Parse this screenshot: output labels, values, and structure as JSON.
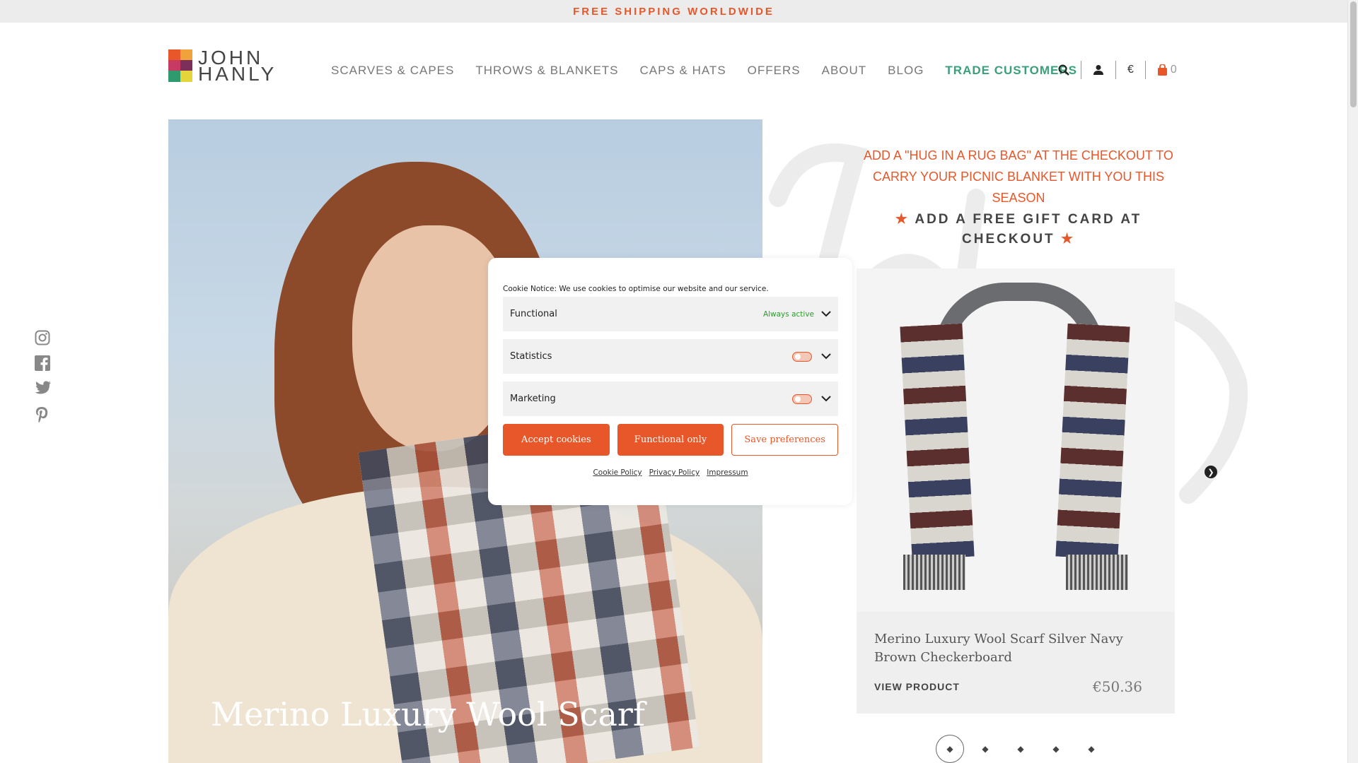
{
  "topbar": {
    "text": "FREE SHIPPING WORLDWIDE"
  },
  "brand": {
    "line1": "JOHN",
    "line2": "HANLY"
  },
  "nav": [
    {
      "label": "SCARVES & CAPES"
    },
    {
      "label": "THROWS & BLANKETS"
    },
    {
      "label": "CAPS & HATS"
    },
    {
      "label": "OFFERS"
    },
    {
      "label": "ABOUT"
    },
    {
      "label": "BLOG"
    },
    {
      "label": "TRADE CUSTOMERS"
    }
  ],
  "header_icons": {
    "search": "search-icon",
    "account": "user-icon",
    "currency": "€",
    "cart_count": "0"
  },
  "social": [
    "instagram-icon",
    "facebook-icon",
    "twitter-icon",
    "pinterest-icon"
  ],
  "hero": {
    "title": "Merino Luxury Wool Scarf"
  },
  "promo": {
    "line1": "ADD A \"HUG IN A RUG BAG\" AT THE CHECKOUT TO CARRY YOUR PICNIC BLANKET WITH YOU THIS SEASON",
    "line2": "ADD A FREE GIFT CARD AT CHECKOUT"
  },
  "product": {
    "name": "Merino Luxury Wool Scarf Silver Navy Brown Checkerboard",
    "cta": "VIEW PRODUCT",
    "price": "€50.36"
  },
  "carousel": {
    "slides": 5,
    "active": 1
  },
  "cookie": {
    "notice_label": "Cookie Notice:",
    "notice_text": "We use cookies to optimise our website and our service.",
    "categories": [
      {
        "name": "Functional",
        "status": "Always active"
      },
      {
        "name": "Statistics",
        "status": ""
      },
      {
        "name": "Marketing",
        "status": ""
      }
    ],
    "buttons": {
      "accept": "Accept cookies",
      "functional": "Functional only",
      "save": "Save preferences"
    },
    "links": {
      "cookie_policy": "Cookie Policy",
      "privacy_policy": "Privacy Policy",
      "impressum": "Impressum"
    }
  },
  "colors": {
    "accent": "#e8572a",
    "trade": "#3aa07a",
    "active_green": "#2e9a2e"
  }
}
